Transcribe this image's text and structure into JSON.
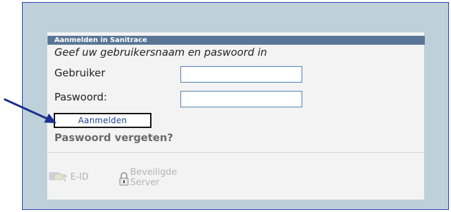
{
  "login": {
    "header": "Aanmelden in Sanitrace",
    "instruction": "Geef uw gebruikersnaam en paswoord in",
    "user_label": "Gebruiker",
    "user_value": "",
    "password_label": "Paswoord:",
    "password_value": "",
    "submit_label": "Aanmelden",
    "forgot_label": "Paswoord vergeten?"
  },
  "footer": {
    "eid_label": "E-ID",
    "secure_line1": "Beveiligde",
    "secure_line2": "Server"
  },
  "icons": {
    "eid": "eid-card-icon",
    "secure": "padlock-icon",
    "pointer": "arrow-pointer-icon"
  },
  "colors": {
    "frame_bg": "#bed0da",
    "frame_border": "#2a3db0",
    "header_bg": "#5a7697",
    "button_text": "#1c3f96",
    "arrow": "#1b2f8f"
  }
}
